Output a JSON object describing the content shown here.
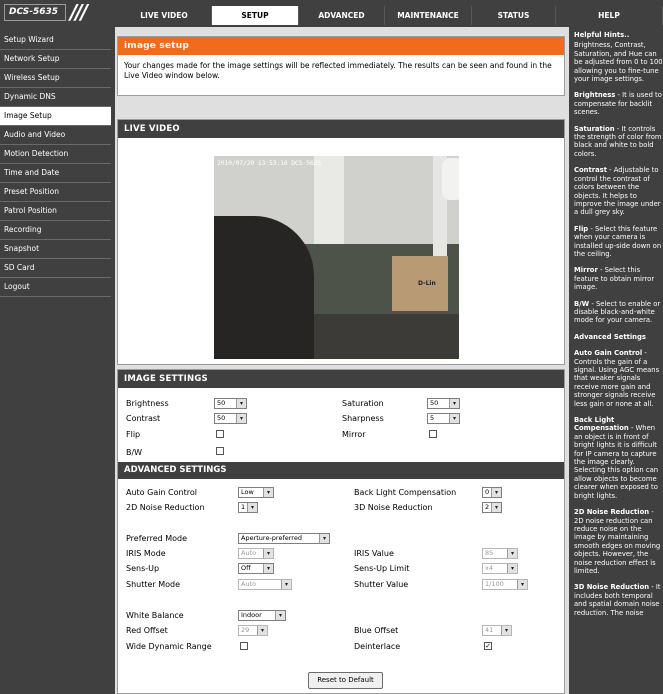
{
  "header": {
    "logo": "DCS-5635",
    "tabs": [
      "LIVE VIDEO",
      "SETUP",
      "ADVANCED",
      "MAINTENANCE",
      "STATUS",
      "HELP"
    ],
    "active_tab": "SETUP"
  },
  "sidebar": {
    "items": [
      "Setup Wizard",
      "Network Setup",
      "Wireless Setup",
      "Dynamic DNS",
      "Image Setup",
      "Audio and Video",
      "Motion Detection",
      "Time and Date",
      "Preset Position",
      "Patrol Position",
      "Recording",
      "Snapshot",
      "SD Card",
      "Logout"
    ],
    "active": "Image Setup"
  },
  "intro": {
    "title": "image setup",
    "text": "Your changes made for the image settings will be reflected immediately. The results can be seen and found in the Live Video window below."
  },
  "live": {
    "title": "LIVE VIDEO",
    "osd": "2010/07/20 13:53:16 DCS-5635",
    "sign": "D-Lin"
  },
  "image_settings": {
    "title": "IMAGE SETTINGS",
    "brightness_label": "Brightness",
    "brightness": "50",
    "saturation_label": "Saturation",
    "saturation": "50",
    "contrast_label": "Contrast",
    "contrast": "50",
    "sharpness_label": "Sharpness",
    "sharpness": "5",
    "flip_label": "Flip",
    "mirror_label": "Mirror",
    "bw_label": "B/W"
  },
  "advanced": {
    "title": "ADVANCED SETTINGS",
    "agc_label": "Auto Gain Control",
    "agc": "Low",
    "blc_label": "Back Light Compensation",
    "blc": "0",
    "nr2d_label": "2D Noise Reduction",
    "nr2d": "1",
    "nr3d_label": "3D Noise Reduction",
    "nr3d": "2",
    "preferred_label": "Preferred Mode",
    "preferred": "Aperture-preferred",
    "iris_mode_label": "IRIS Mode",
    "iris_mode": "Auto",
    "iris_value_label": "IRIS Value",
    "iris_value": "85",
    "sensup_label": "Sens-Up",
    "sensup": "Off",
    "sensup_limit_label": "Sens-Up Limit",
    "sensup_limit": "x4",
    "shutter_mode_label": "Shutter Mode",
    "shutter_mode": "Auto",
    "shutter_value_label": "Shutter Value",
    "shutter_value": "1/100",
    "wb_label": "White Balance",
    "wb": "Indoor",
    "red_label": "Red Offset",
    "red": "29",
    "blue_label": "Blue Offset",
    "blue": "41",
    "wdr_label": "Wide Dynamic Range",
    "deinterlace_label": "Deinterlace",
    "deinterlace_checked": "✓",
    "reset_label": "Reset to Default"
  },
  "help": {
    "title": "Helpful Hints..",
    "p1": "Brightness, Contrast, Saturation, and Hue can be adjusted from 0 to 100 allowing you to fine-tune your image settings.",
    "brightness_h": "Brightness",
    "brightness_t": " - It is used to compensate for backlit scenes.",
    "saturation_h": "Saturation",
    "saturation_t": " - It controls the strength of color from black and white to bold colors.",
    "contrast_h": "Contrast",
    "contrast_t": " - Adjustable to control the contrast of colors between the objects. It helps to improve the image under a dull grey sky.",
    "flip_h": "Flip",
    "flip_t": " - Select this feature when your camera is installed up-side down on the ceiling.",
    "mirror_h": "Mirror",
    "mirror_t": " - Select this feature to obtain mirror image.",
    "bw_h": "B/W",
    "bw_t": " - Select to enable or disable black-and-white mode for your camera.",
    "adv_h": "Advanced Settings",
    "agc_h": "Auto Gain Control",
    "agc_t": " - Controls the gain of a signal. Using AGC means that weaker signals receive more gain and stronger signals receive less gain or none at all.",
    "blc_h": "Back Light Compensation",
    "blc_t": " - When an object is in front of bright lights it is difficult for IP camera to capture the image clearly. Selecting this option can allow objects to become clearer when exposed to bright lights.",
    "nr2d_h": "2D Noise Reduction",
    "nr2d_t": " - 2D noise reduction can reduce noise on the image by maintaining smooth edges on moving objects. However, the noise reduction effect is limited.",
    "nr3d_h": "3D Noise Reduction",
    "nr3d_t": " - It includes both temporal and spatial domain noise reduction. The noise"
  }
}
